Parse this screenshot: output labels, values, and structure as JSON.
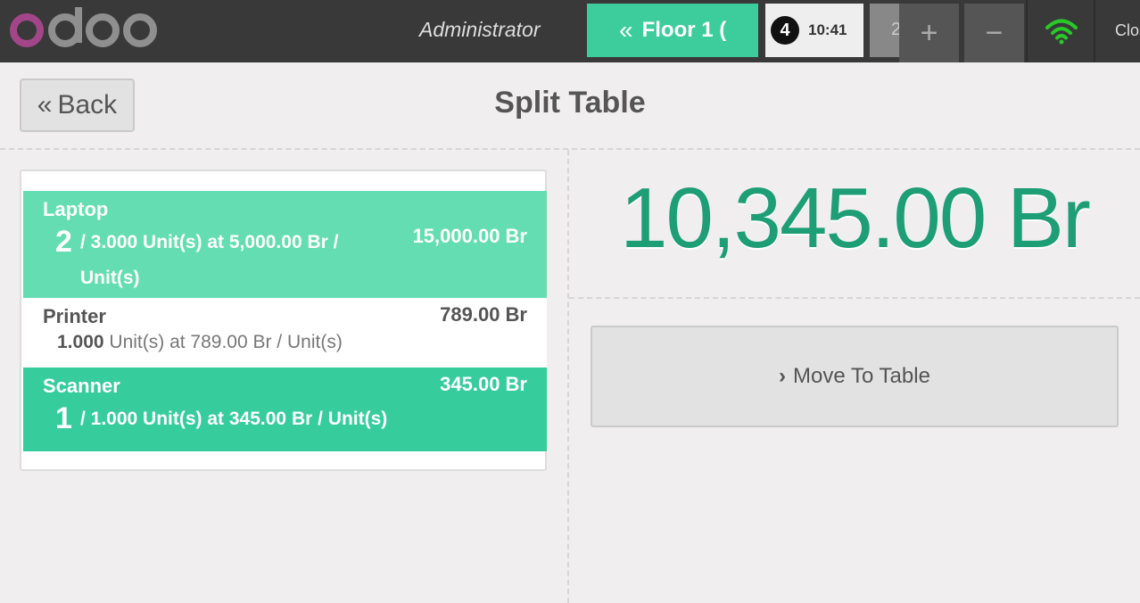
{
  "topbar": {
    "cashier": "Administrator",
    "floor_button": {
      "chevron": "«",
      "label": "Floor 1 ("
    },
    "order": {
      "count": "4",
      "time": "10:41"
    },
    "order_partial": "2",
    "add_icon": "+",
    "remove_icon": "−",
    "network_icon": "wifi-icon",
    "close_label": "Close"
  },
  "header": {
    "back_chevron": "«",
    "back_label": "Back",
    "title": "Split Table"
  },
  "orderlines": [
    {
      "product": "Laptop",
      "split_qty": "2",
      "info": "/ 3.000 Unit(s) at 5,000.00 Br / Unit(s)",
      "price": "15,000.00 Br",
      "selected": true
    },
    {
      "product": "Printer",
      "qty": "1.000",
      "info": " Unit(s) at 789.00 Br / Unit(s)",
      "price": "789.00 Br",
      "selected": false
    },
    {
      "product": "Scanner",
      "split_qty": "1",
      "info": "/ 1.000 Unit(s) at 345.00 Br / Unit(s)",
      "price": "345.00 Br",
      "selected": true
    }
  ],
  "summary": {
    "total": "10,345.00 Br",
    "move_chevron": "›",
    "move_label": "Move To Table"
  },
  "colors": {
    "topbar": "#393939",
    "accent": "#3dcc9c",
    "line_selected_light": "#65ddb3",
    "line_selected": "#37cc9b",
    "total_text": "#1e9e75",
    "logo_purple": "#a24689",
    "logo_gray": "#8f8f8f",
    "wifi_green": "#28c928"
  }
}
